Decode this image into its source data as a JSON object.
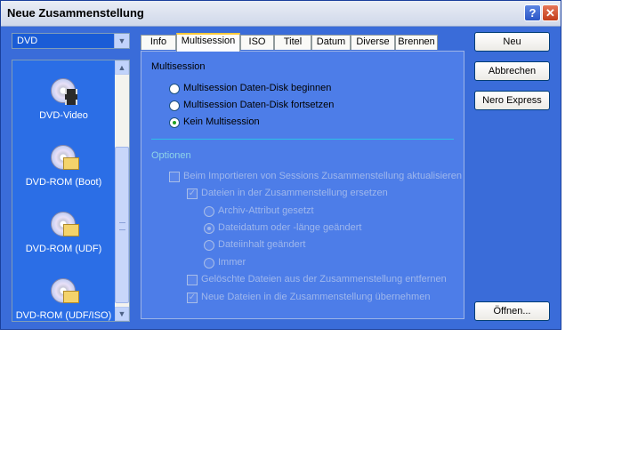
{
  "window": {
    "title": "Neue Zusammenstellung"
  },
  "sidebar": {
    "combo_value": "DVD",
    "items": [
      {
        "label": "DVD-Video",
        "icon": "dvd-video-icon"
      },
      {
        "label": "DVD-ROM (Boot)",
        "icon": "dvd-rom-boot-icon"
      },
      {
        "label": "DVD-ROM (UDF)",
        "icon": "dvd-rom-udf-icon"
      },
      {
        "label": "DVD-ROM (UDF/ISO)",
        "icon": "dvd-rom-udf-iso-icon"
      }
    ]
  },
  "tabs": [
    "Info",
    "Multisession",
    "ISO",
    "Titel",
    "Datum",
    "Diverse",
    "Brennen"
  ],
  "active_tab": "Multisession",
  "multisession": {
    "heading": "Multisession",
    "options": [
      "Multisession Daten-Disk beginnen",
      "Multisession Daten-Disk fortsetzen",
      "Kein Multisession"
    ],
    "selected": "Kein Multisession"
  },
  "optionen": {
    "heading": "Optionen",
    "import_update": "Beim Importieren von Sessions Zusammenstellung aktualisieren",
    "replace_files": "Dateien in der Zusammenstellung ersetzen",
    "replace_conditions": [
      "Archiv-Attribut gesetzt",
      "Dateidatum oder -länge geändert",
      "Dateiinhalt geändert",
      "Immer"
    ],
    "remove_deleted": "Gelöschte Dateien aus der Zusammenstellung entfernen",
    "take_new": "Neue Dateien in die Zusammenstellung übernehmen"
  },
  "buttons": {
    "new": "Neu",
    "cancel": "Abbrechen",
    "nero_express": "Nero Express",
    "open": "Öffnen..."
  },
  "colors": {
    "window_blue": "#3a6cd9",
    "tab_highlight": "#ffc83c",
    "separator": "#2dc0e8"
  }
}
